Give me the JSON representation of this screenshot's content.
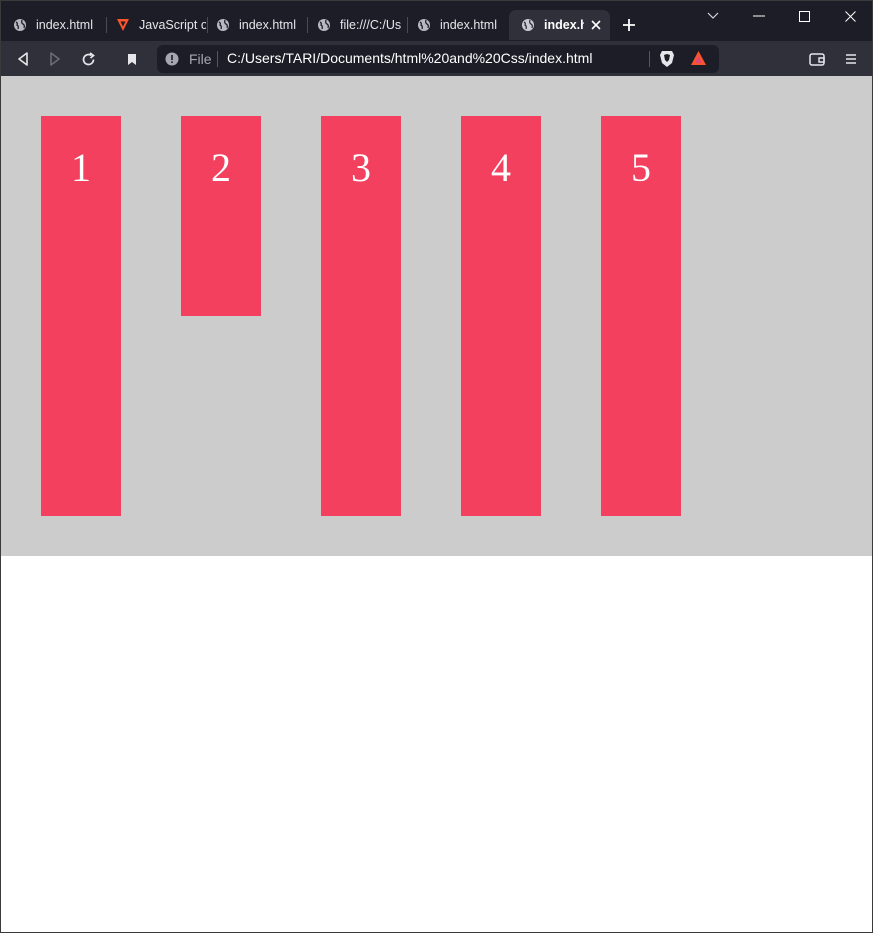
{
  "tabs": [
    {
      "label": "index.html",
      "favicon": "globe-icon",
      "active": false
    },
    {
      "label": "JavaScript o",
      "favicon": "brave-search-icon",
      "active": false
    },
    {
      "label": "index.html",
      "favicon": "globe-icon",
      "active": false
    },
    {
      "label": "file:///C:/Us",
      "favicon": "globe-icon",
      "active": false
    },
    {
      "label": "index.html",
      "favicon": "globe-icon",
      "active": false
    },
    {
      "label": "index.ht",
      "favicon": "globe-icon",
      "active": true
    }
  ],
  "address_bar": {
    "scheme_label": "File",
    "url": "C:/Users/TARI/Documents/html%20and%20Css/index.html"
  },
  "page": {
    "container_color": "#cccccc",
    "box_color": "#f2405e",
    "boxes": [
      {
        "label": "1",
        "size": "full"
      },
      {
        "label": "2",
        "size": "half"
      },
      {
        "label": "3",
        "size": "full"
      },
      {
        "label": "4",
        "size": "full"
      },
      {
        "label": "5",
        "size": "full"
      }
    ]
  },
  "colors": {
    "tabstrip_bg": "#1c1d26",
    "toolbar_bg": "#2f303a",
    "brave_accent": "#fb542b"
  }
}
